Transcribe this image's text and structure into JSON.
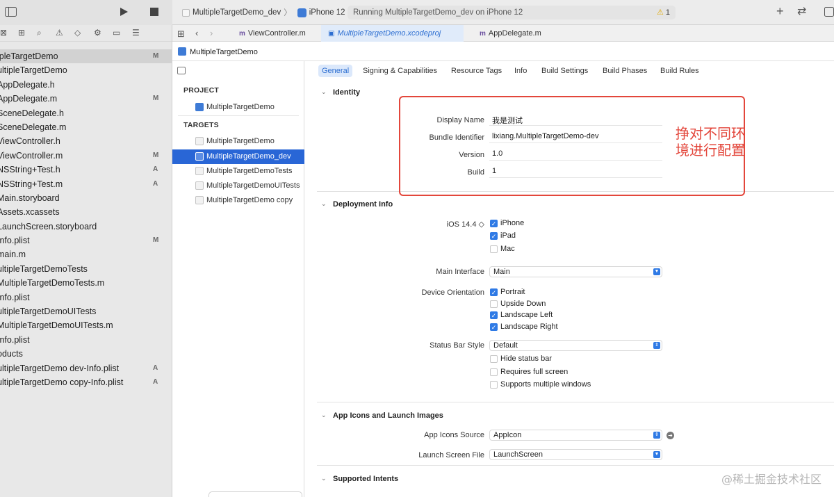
{
  "toolbar": {
    "scheme": "MultipleTargetDemo_dev",
    "device": "iPhone 12",
    "activity": "Running MultipleTargetDemo_dev on iPhone 12",
    "warning_count": "1"
  },
  "navigator": {
    "items": [
      {
        "label": "ipleTargetDemo",
        "status": "M",
        "selected": true
      },
      {
        "label": "ultipleTargetDemo",
        "status": ""
      },
      {
        "label": "AppDelegate.h",
        "status": ""
      },
      {
        "label": "AppDelegate.m",
        "status": "M"
      },
      {
        "label": "SceneDelegate.h",
        "status": ""
      },
      {
        "label": "SceneDelegate.m",
        "status": ""
      },
      {
        "label": "ViewController.h",
        "status": ""
      },
      {
        "label": "ViewController.m",
        "status": "M"
      },
      {
        "label": "NSString+Test.h",
        "status": "A"
      },
      {
        "label": "NSString+Test.m",
        "status": "A"
      },
      {
        "label": "Main.storyboard",
        "status": ""
      },
      {
        "label": "Assets.xcassets",
        "status": ""
      },
      {
        "label": "LaunchScreen.storyboard",
        "status": ""
      },
      {
        "label": "Info.plist",
        "status": "M"
      },
      {
        "label": "main.m",
        "status": ""
      },
      {
        "label": "ultipleTargetDemoTests",
        "status": ""
      },
      {
        "label": "MultipleTargetDemoTests.m",
        "status": ""
      },
      {
        "label": "Info.plist",
        "status": ""
      },
      {
        "label": "ultipleTargetDemoUITests",
        "status": ""
      },
      {
        "label": "MultipleTargetDemoUITests.m",
        "status": ""
      },
      {
        "label": "Info.plist",
        "status": ""
      },
      {
        "label": "oducts",
        "status": ""
      },
      {
        "label": "ultipleTargetDemo dev-Info.plist",
        "status": "A"
      },
      {
        "label": "ultipleTargetDemo copy-Info.plist",
        "status": "A"
      }
    ]
  },
  "editor_tabs": [
    {
      "label": "ViewController.m",
      "badge": "m"
    },
    {
      "label": "MultipleTargetDemo.xcodeproj",
      "badge": ""
    },
    {
      "label": "AppDelegate.m",
      "badge": "m"
    }
  ],
  "breadcrumb": "MultipleTargetDemo",
  "targets_panel": {
    "project_header": "PROJECT",
    "project": "MultipleTargetDemo",
    "targets_header": "TARGETS",
    "targets": [
      "MultipleTargetDemo",
      "MultipleTargetDemo_dev",
      "MultipleTargetDemoTests",
      "MultipleTargetDemoUITests",
      "MultipleTargetDemo copy"
    ]
  },
  "settings_tabs": [
    "General",
    "Signing & Capabilities",
    "Resource Tags",
    "Info",
    "Build Settings",
    "Build Phases",
    "Build Rules"
  ],
  "identity": {
    "title": "Identity",
    "display_name_label": "Display Name",
    "display_name": "我是测试",
    "bundle_id_label": "Bundle Identifier",
    "bundle_id": "lixiang.MultipleTargetDemo-dev",
    "version_label": "Version",
    "version": "1.0",
    "build_label": "Build",
    "build": "1"
  },
  "deployment": {
    "title": "Deployment Info",
    "ios_label": "iOS 14.4 ◇",
    "devices": [
      {
        "label": "iPhone",
        "checked": true
      },
      {
        "label": "iPad",
        "checked": true
      },
      {
        "label": "Mac",
        "checked": false
      }
    ],
    "main_interface_label": "Main Interface",
    "main_interface": "Main",
    "orientation_label": "Device Orientation",
    "orientations": [
      {
        "label": "Portrait",
        "checked": true
      },
      {
        "label": "Upside Down",
        "checked": false
      },
      {
        "label": "Landscape Left",
        "checked": true
      },
      {
        "label": "Landscape Right",
        "checked": true
      }
    ],
    "status_bar_label": "Status Bar Style",
    "status_bar": "Default",
    "status_options": [
      {
        "label": "Hide status bar",
        "checked": false
      },
      {
        "label": "Requires full screen",
        "checked": false
      },
      {
        "label": "Supports multiple windows",
        "checked": false
      }
    ]
  },
  "app_icons": {
    "title": "App Icons and Launch Images",
    "source_label": "App Icons Source",
    "source": "AppIcon",
    "launch_label": "Launch Screen File",
    "launch": "LaunchScreen"
  },
  "intents": {
    "title": "Supported Intents"
  },
  "annotation": {
    "text": "挣对不同环境进行配置",
    "color": "#e3463b"
  },
  "watermark": "@稀土掘金技术社区",
  "colors": {
    "accent": "#2966d6",
    "annotation": "#e3463b"
  }
}
